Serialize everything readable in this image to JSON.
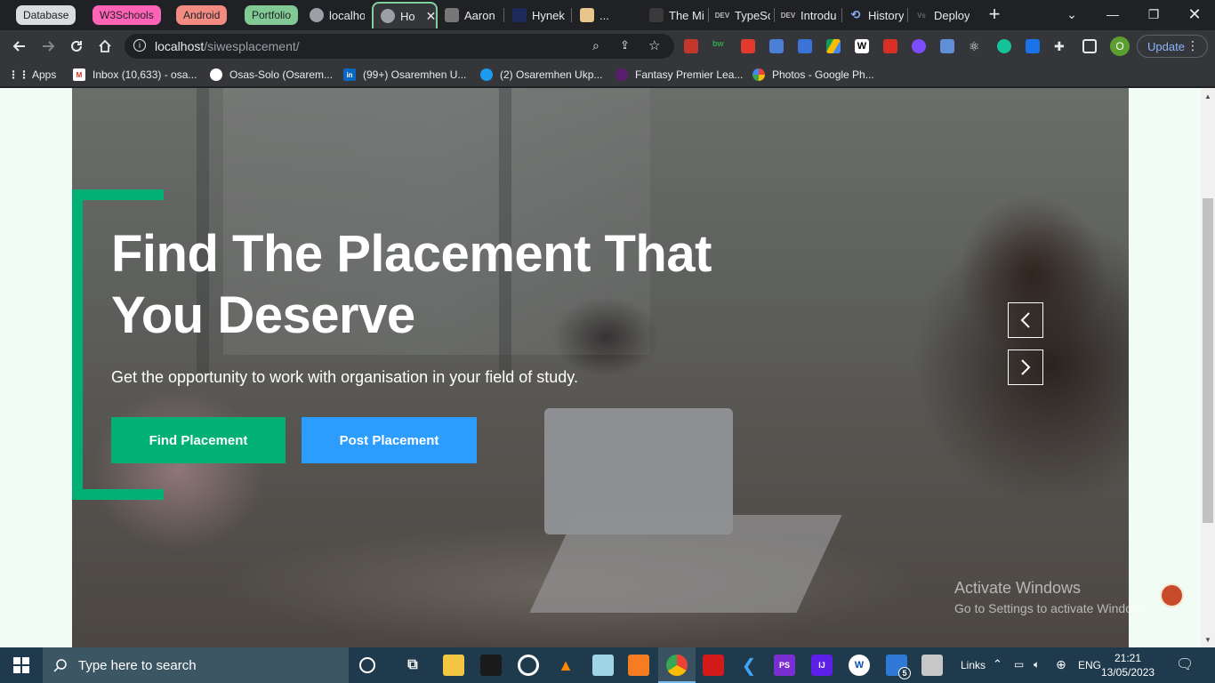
{
  "browser": {
    "tab_groups": [
      {
        "label": "Database",
        "bg": "#dadce0",
        "fg": "#202124"
      },
      {
        "label": "W3Schools",
        "bg": "#ff63b8",
        "fg": "#202124"
      },
      {
        "label": "Android",
        "bg": "#f28b82",
        "fg": "#202124"
      },
      {
        "label": "Portfolio",
        "bg": "#81c995",
        "fg": "#202124"
      }
    ],
    "tabs": [
      {
        "label": "localho",
        "icon": "globe-icon"
      },
      {
        "label": "Ho",
        "icon": "globe-icon",
        "active": true
      },
      {
        "label": "Aaron",
        "icon": "profile-photo-icon"
      },
      {
        "label": "Hynek",
        "icon": "ghost-icon"
      },
      {
        "label": "...",
        "icon": "character-icon"
      },
      {
        "label": "The Mi",
        "icon": "dark-logo-icon"
      },
      {
        "label": "TypeSc",
        "icon": "dev-icon"
      },
      {
        "label": "Introdu",
        "icon": "dev-icon"
      },
      {
        "label": "History",
        "icon": "history-icon"
      },
      {
        "label": "Deploy",
        "icon": "vs-icon"
      }
    ],
    "address": {
      "host": "localhost",
      "path": "/siwesplacement/"
    },
    "update_label": "Update",
    "profile_initial": "O",
    "bookmarks": [
      {
        "label": "Apps",
        "icon": "apps-grid-icon"
      },
      {
        "label": "Inbox (10,633) - osa...",
        "icon": "gmail-icon"
      },
      {
        "label": "Osas-Solo (Osarem...",
        "icon": "github-icon"
      },
      {
        "label": "(99+) Osaremhen U...",
        "icon": "linkedin-icon"
      },
      {
        "label": "(2) Osaremhen Ukp...",
        "icon": "twitter-icon"
      },
      {
        "label": "Fantasy Premier Lea...",
        "icon": "premier-league-icon"
      },
      {
        "label": "Photos - Google Ph...",
        "icon": "google-photos-icon"
      }
    ]
  },
  "hero": {
    "title": "Find The Placement That You Deserve",
    "subtitle": "Get the opportunity to work with organisation in your field of study.",
    "find_label": "Find Placement",
    "post_label": "Post Placement",
    "accent": "#00b074",
    "post_color": "#2d9cff"
  },
  "watermark": {
    "line1": "Activate Windows",
    "line2": "Go to Settings to activate Windows."
  },
  "taskbar": {
    "search_placeholder": "Type here to search",
    "links_label": "Links",
    "language": "ENG",
    "time": "21:21",
    "date": "13/05/2023",
    "badge_count": "5"
  }
}
